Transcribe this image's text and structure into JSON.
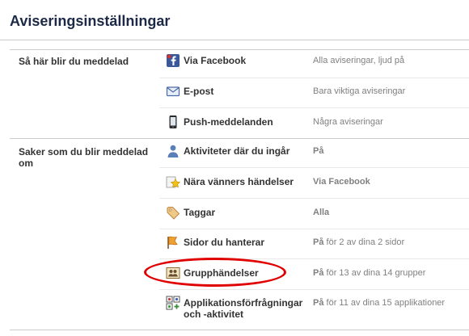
{
  "page": {
    "title": "Aviseringsinställningar"
  },
  "colors": {
    "highlight": "#e00000",
    "label": "#333333",
    "value": "#808080",
    "title": "#1c2a47"
  },
  "sections": [
    {
      "label": "Så här blir du meddelad",
      "rows": [
        {
          "icon": "facebook-icon",
          "label": "Via Facebook",
          "value_bold": "",
          "value": "Alla aviseringar, ljud på"
        },
        {
          "icon": "envelope-icon",
          "label": "E-post",
          "value_bold": "",
          "value": "Bara viktiga aviseringar"
        },
        {
          "icon": "phone-icon",
          "label": "Push-meddelanden",
          "value_bold": "",
          "value": "Några aviseringar"
        }
      ]
    },
    {
      "label": "Saker som du blir meddelad om",
      "rows": [
        {
          "icon": "person-icon",
          "label": "Aktiviteter där du ingår",
          "value_bold": "På",
          "value": ""
        },
        {
          "icon": "star-icon",
          "label": "Nära vänners händelser",
          "value_bold": "Via Facebook",
          "value": ""
        },
        {
          "icon": "tag-icon",
          "label": "Taggar",
          "value_bold": "Alla",
          "value": ""
        },
        {
          "icon": "flag-icon",
          "label": "Sidor du hanterar",
          "value_bold": "På",
          "value": " för 2 av dina 2 sidor"
        },
        {
          "icon": "group-icon",
          "label": "Grupphändelser",
          "value_bold": "På",
          "value": " för 13 av dina 14 grupper"
        },
        {
          "icon": "apps-icon",
          "label": "Applikationsförfrågningar och -aktivitet",
          "value_bold": "På",
          "value": " för 11 av dina 15 applikationer"
        }
      ]
    }
  ]
}
